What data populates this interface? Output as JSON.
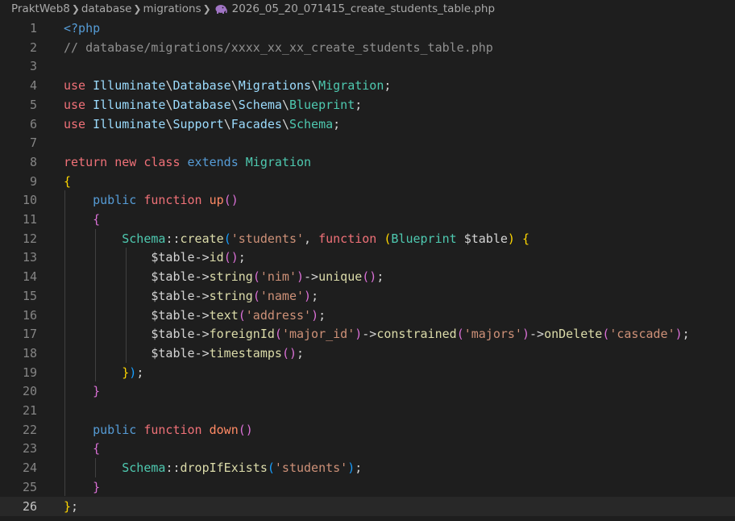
{
  "breadcrumb": {
    "items": [
      "PraktWeb8",
      "database",
      "migrations"
    ],
    "file": "2026_05_20_071415_create_students_table.php",
    "file_icon": "php-elephant-icon"
  },
  "editor": {
    "current_line": 26,
    "lines": [
      {
        "n": "1",
        "tokens": [
          [
            "<?php",
            "t-tag"
          ]
        ]
      },
      {
        "n": "2",
        "tokens": [
          [
            "// database/migrations/xxxx_xx_xx_create_students_table.php",
            "t-cmt"
          ]
        ]
      },
      {
        "n": "3",
        "tokens": []
      },
      {
        "n": "4",
        "tokens": [
          [
            "use ",
            "t-kws"
          ],
          [
            "Illuminate",
            "t-ns"
          ],
          [
            "\\",
            "t-op"
          ],
          [
            "Database",
            "t-ns"
          ],
          [
            "\\",
            "t-op"
          ],
          [
            "Migrations",
            "t-ns"
          ],
          [
            "\\",
            "t-op"
          ],
          [
            "Migration",
            "t-cls"
          ],
          [
            ";",
            "t-op"
          ]
        ]
      },
      {
        "n": "5",
        "tokens": [
          [
            "use ",
            "t-kws"
          ],
          [
            "Illuminate",
            "t-ns"
          ],
          [
            "\\",
            "t-op"
          ],
          [
            "Database",
            "t-ns"
          ],
          [
            "\\",
            "t-op"
          ],
          [
            "Schema",
            "t-ns"
          ],
          [
            "\\",
            "t-op"
          ],
          [
            "Blueprint",
            "t-cls"
          ],
          [
            ";",
            "t-op"
          ]
        ]
      },
      {
        "n": "6",
        "tokens": [
          [
            "use ",
            "t-kws"
          ],
          [
            "Illuminate",
            "t-ns"
          ],
          [
            "\\",
            "t-op"
          ],
          [
            "Support",
            "t-ns"
          ],
          [
            "\\",
            "t-op"
          ],
          [
            "Facades",
            "t-ns"
          ],
          [
            "\\",
            "t-op"
          ],
          [
            "Schema",
            "t-cls"
          ],
          [
            ";",
            "t-op"
          ]
        ]
      },
      {
        "n": "7",
        "tokens": []
      },
      {
        "n": "8",
        "tokens": [
          [
            "return ",
            "t-kws"
          ],
          [
            "new ",
            "t-kws"
          ],
          [
            "class ",
            "t-kws"
          ],
          [
            "extends ",
            "t-blue"
          ],
          [
            "Migration",
            "t-cls"
          ]
        ]
      },
      {
        "n": "9",
        "tokens": [
          [
            "{",
            "t-b1"
          ]
        ]
      },
      {
        "n": "10",
        "tokens": [
          [
            "    ",
            ""
          ],
          [
            "public ",
            "t-blue"
          ],
          [
            "function ",
            "t-kws"
          ],
          [
            "up",
            "t-fn2"
          ],
          [
            "()",
            "t-b2"
          ]
        ]
      },
      {
        "n": "11",
        "tokens": [
          [
            "    ",
            ""
          ],
          [
            "{",
            "t-b2"
          ]
        ]
      },
      {
        "n": "12",
        "tokens": [
          [
            "        ",
            ""
          ],
          [
            "Schema",
            "t-cls"
          ],
          [
            "::",
            "t-op"
          ],
          [
            "create",
            "t-fn"
          ],
          [
            "(",
            "t-b3"
          ],
          [
            "'students'",
            "t-str"
          ],
          [
            ", ",
            "t-op"
          ],
          [
            "function ",
            "t-kws"
          ],
          [
            "(",
            "t-b1"
          ],
          [
            "Blueprint ",
            "t-cls"
          ],
          [
            "$table",
            "t-var"
          ],
          [
            ") ",
            "t-b1"
          ],
          [
            "{",
            "t-b1"
          ]
        ]
      },
      {
        "n": "13",
        "tokens": [
          [
            "            ",
            ""
          ],
          [
            "$table",
            "t-var"
          ],
          [
            "->",
            "t-op"
          ],
          [
            "id",
            "t-fn"
          ],
          [
            "()",
            "t-b2"
          ],
          [
            ";",
            "t-op"
          ]
        ]
      },
      {
        "n": "14",
        "tokens": [
          [
            "            ",
            ""
          ],
          [
            "$table",
            "t-var"
          ],
          [
            "->",
            "t-op"
          ],
          [
            "string",
            "t-fn"
          ],
          [
            "(",
            "t-b2"
          ],
          [
            "'nim'",
            "t-str"
          ],
          [
            ")",
            "t-b2"
          ],
          [
            "->",
            "t-op"
          ],
          [
            "unique",
            "t-fn"
          ],
          [
            "()",
            "t-b2"
          ],
          [
            ";",
            "t-op"
          ]
        ]
      },
      {
        "n": "15",
        "tokens": [
          [
            "            ",
            ""
          ],
          [
            "$table",
            "t-var"
          ],
          [
            "->",
            "t-op"
          ],
          [
            "string",
            "t-fn"
          ],
          [
            "(",
            "t-b2"
          ],
          [
            "'name'",
            "t-str"
          ],
          [
            ")",
            "t-b2"
          ],
          [
            ";",
            "t-op"
          ]
        ]
      },
      {
        "n": "16",
        "tokens": [
          [
            "            ",
            ""
          ],
          [
            "$table",
            "t-var"
          ],
          [
            "->",
            "t-op"
          ],
          [
            "text",
            "t-fn"
          ],
          [
            "(",
            "t-b2"
          ],
          [
            "'address'",
            "t-str"
          ],
          [
            ")",
            "t-b2"
          ],
          [
            ";",
            "t-op"
          ]
        ]
      },
      {
        "n": "17",
        "tokens": [
          [
            "            ",
            ""
          ],
          [
            "$table",
            "t-var"
          ],
          [
            "->",
            "t-op"
          ],
          [
            "foreignId",
            "t-fn"
          ],
          [
            "(",
            "t-b2"
          ],
          [
            "'major_id'",
            "t-str"
          ],
          [
            ")",
            "t-b2"
          ],
          [
            "->",
            "t-op"
          ],
          [
            "constrained",
            "t-fn"
          ],
          [
            "(",
            "t-b2"
          ],
          [
            "'majors'",
            "t-str"
          ],
          [
            ")",
            "t-b2"
          ],
          [
            "->",
            "t-op"
          ],
          [
            "onDelete",
            "t-fn"
          ],
          [
            "(",
            "t-b2"
          ],
          [
            "'cascade'",
            "t-str"
          ],
          [
            ")",
            "t-b2"
          ],
          [
            ";",
            "t-op"
          ]
        ]
      },
      {
        "n": "18",
        "tokens": [
          [
            "            ",
            ""
          ],
          [
            "$table",
            "t-var"
          ],
          [
            "->",
            "t-op"
          ],
          [
            "timestamps",
            "t-fn"
          ],
          [
            "()",
            "t-b2"
          ],
          [
            ";",
            "t-op"
          ]
        ]
      },
      {
        "n": "19",
        "tokens": [
          [
            "        ",
            ""
          ],
          [
            "}",
            "t-b1"
          ],
          [
            ")",
            "t-b3"
          ],
          [
            ";",
            "t-op"
          ]
        ]
      },
      {
        "n": "20",
        "tokens": [
          [
            "    ",
            ""
          ],
          [
            "}",
            "t-b2"
          ]
        ]
      },
      {
        "n": "21",
        "tokens": []
      },
      {
        "n": "22",
        "tokens": [
          [
            "    ",
            ""
          ],
          [
            "public ",
            "t-blue"
          ],
          [
            "function ",
            "t-kws"
          ],
          [
            "down",
            "t-fn2"
          ],
          [
            "()",
            "t-b2"
          ]
        ]
      },
      {
        "n": "23",
        "tokens": [
          [
            "    ",
            ""
          ],
          [
            "{",
            "t-b2"
          ]
        ]
      },
      {
        "n": "24",
        "tokens": [
          [
            "        ",
            ""
          ],
          [
            "Schema",
            "t-cls"
          ],
          [
            "::",
            "t-op"
          ],
          [
            "dropIfExists",
            "t-fn"
          ],
          [
            "(",
            "t-b3"
          ],
          [
            "'students'",
            "t-str"
          ],
          [
            ")",
            "t-b3"
          ],
          [
            ";",
            "t-op"
          ]
        ]
      },
      {
        "n": "25",
        "tokens": [
          [
            "    ",
            ""
          ],
          [
            "}",
            "t-b2"
          ]
        ]
      },
      {
        "n": "26",
        "tokens": [
          [
            "}",
            "t-b1"
          ],
          [
            ";",
            "t-op"
          ]
        ]
      }
    ]
  }
}
